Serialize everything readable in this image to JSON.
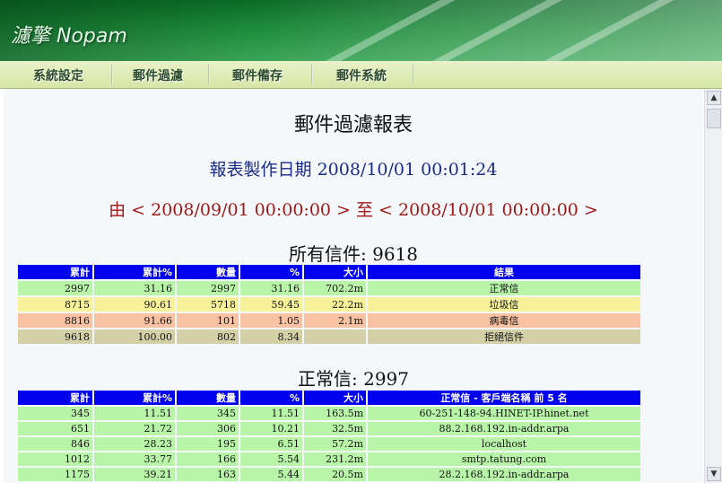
{
  "app": {
    "brand": "濾擎 Nopam"
  },
  "menu": {
    "items": [
      "系統設定",
      "郵件過濾",
      "郵件備存",
      "郵件系統"
    ]
  },
  "report": {
    "title": "郵件過濾報表",
    "created_label": "報表製作日期 2008/10/01 00:01:24",
    "range_label": "由 < 2008/09/01 00:00:00 > 至 < 2008/10/01 00:00:00 >"
  },
  "all_mail": {
    "title": "所有信件: 9618",
    "headers": [
      "累計",
      "累計%",
      "數量",
      "%",
      "大小",
      "結果"
    ],
    "rows": [
      {
        "cells": [
          "2997",
          "31.16",
          "2997",
          "31.16",
          "702.2m",
          "正常信"
        ],
        "color": "#b9f5a9"
      },
      {
        "cells": [
          "8715",
          "90.61",
          "5718",
          "59.45",
          "22.2m",
          "垃圾信"
        ],
        "color": "#f7f29a"
      },
      {
        "cells": [
          "8816",
          "91.66",
          "101",
          "1.05",
          "2.1m",
          "病毒信"
        ],
        "color": "#f8c2a3"
      },
      {
        "cells": [
          "9618",
          "100.00",
          "802",
          "8.34",
          "",
          "拒絕信件"
        ],
        "color": "#d3cfa6"
      }
    ]
  },
  "normal_mail": {
    "title": "正常信: 2997",
    "headers": [
      "累計",
      "累計%",
      "數量",
      "%",
      "大小",
      "正常信 - 客戶端名稱 前 5 名"
    ],
    "rows": [
      {
        "cells": [
          "345",
          "11.51",
          "345",
          "11.51",
          "163.5m",
          "60-251-148-94.HINET-IP.hinet.net"
        ],
        "color": "#b9f5a9"
      },
      {
        "cells": [
          "651",
          "21.72",
          "306",
          "10.21",
          "32.5m",
          "88.2.168.192.in-addr.arpa"
        ],
        "color": "#b9f5a9"
      },
      {
        "cells": [
          "846",
          "28.23",
          "195",
          "6.51",
          "57.2m",
          "localhost"
        ],
        "color": "#b9f5a9"
      },
      {
        "cells": [
          "1012",
          "33.77",
          "166",
          "5.54",
          "231.2m",
          "smtp.tatung.com"
        ],
        "color": "#b9f5a9"
      },
      {
        "cells": [
          "1175",
          "39.21",
          "163",
          "5.44",
          "20.5m",
          "28.2.168.192.in-addr.arpa"
        ],
        "color": "#b9f5a9"
      }
    ]
  },
  "scrollbar": {
    "up_icon": "▲",
    "down_icon": "▼"
  }
}
